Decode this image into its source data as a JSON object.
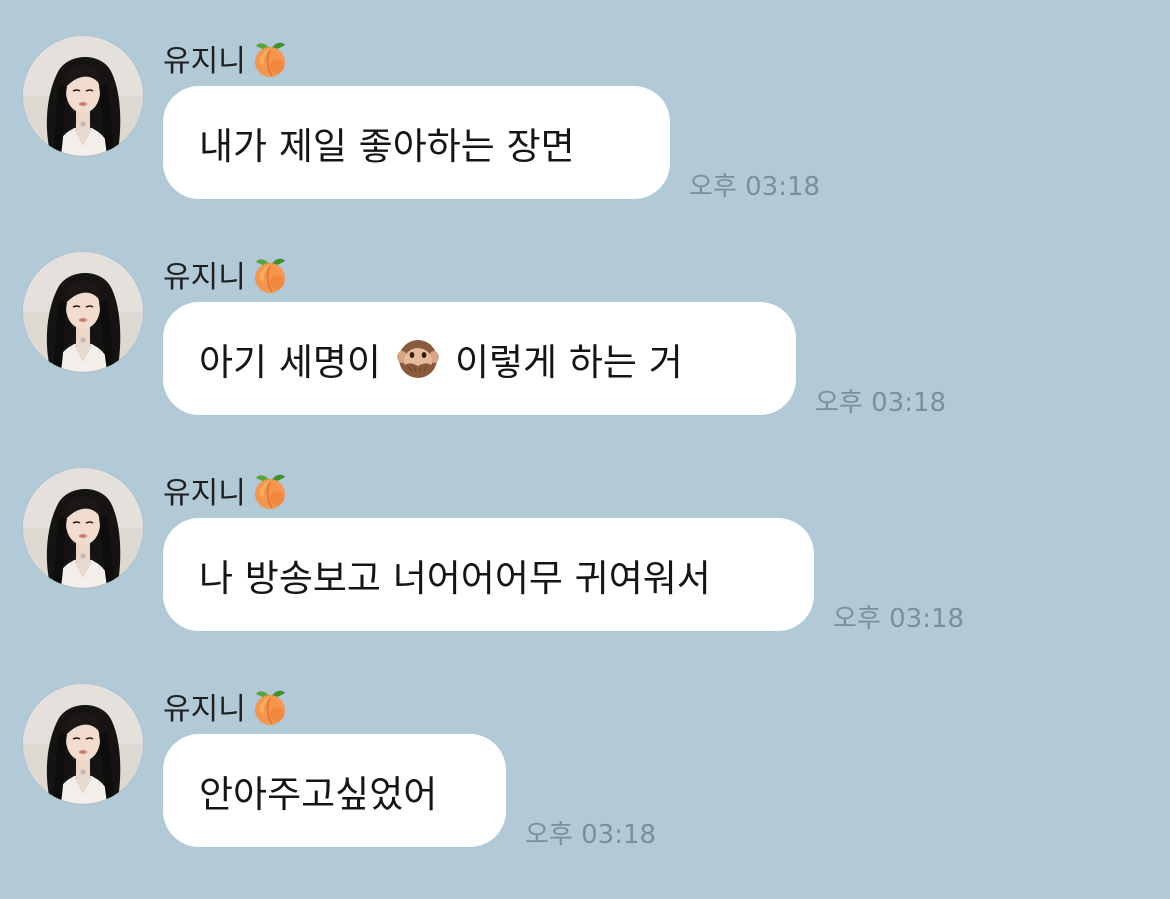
{
  "chat": {
    "messages": [
      {
        "sender": "유지니",
        "sender_emoji": "peach-emoji",
        "text": "내가 제일 좋아하는 장면",
        "time": "오후 03:18"
      },
      {
        "sender": "유지니",
        "sender_emoji": "peach-emoji",
        "text_before": "아기 세명이",
        "inline_emoji": "speak-no-evil-monkey-emoji",
        "text_after": "이렇게 하는 거",
        "time": "오후 03:18"
      },
      {
        "sender": "유지니",
        "sender_emoji": "peach-emoji",
        "text": "나 방송보고 너어어어무 귀여워서",
        "time": "오후 03:18"
      },
      {
        "sender": "유지니",
        "sender_emoji": "peach-emoji",
        "text": "안아주고싶었어",
        "time": "오후 03:18"
      }
    ]
  },
  "colors": {
    "background": "#b2c9d8",
    "bubble": "#ffffff",
    "timestamp": "#7e8e99"
  }
}
